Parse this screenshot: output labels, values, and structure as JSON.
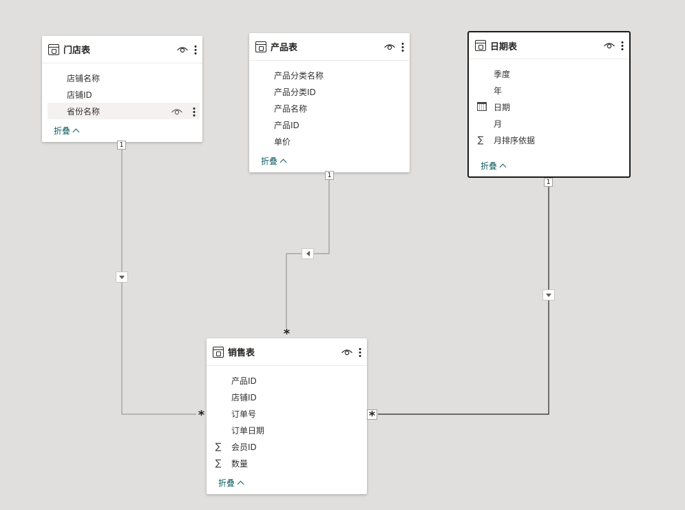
{
  "tables": [
    {
      "title": "门店表",
      "fields": [
        {
          "name": "店铺名称",
          "icon": ""
        },
        {
          "name": "店铺ID",
          "icon": ""
        },
        {
          "name": "省份名称",
          "icon": "",
          "hovered": true
        }
      ],
      "collapse_label": "折叠"
    },
    {
      "title": "产品表",
      "fields": [
        {
          "name": "产品分类名称",
          "icon": ""
        },
        {
          "name": "产品分类ID",
          "icon": ""
        },
        {
          "name": "产品名称",
          "icon": ""
        },
        {
          "name": "产品ID",
          "icon": ""
        },
        {
          "name": "单价",
          "icon": ""
        }
      ],
      "collapse_label": "折叠"
    },
    {
      "title": "日期表",
      "selected": true,
      "fields": [
        {
          "name": "季度",
          "icon": ""
        },
        {
          "name": "年",
          "icon": ""
        },
        {
          "name": "日期",
          "icon": "calendar-icon"
        },
        {
          "name": "月",
          "icon": ""
        },
        {
          "name": "月排序依据",
          "icon": "sigma-icon"
        }
      ],
      "collapse_label": "折叠"
    },
    {
      "title": "销售表",
      "fields": [
        {
          "name": "产品ID",
          "icon": ""
        },
        {
          "name": "店铺ID",
          "icon": ""
        },
        {
          "name": "订单号",
          "icon": ""
        },
        {
          "name": "订单日期",
          "icon": ""
        },
        {
          "name": "会员ID",
          "icon": "sigma-icon"
        },
        {
          "name": "数量",
          "icon": "sigma-icon"
        }
      ],
      "collapse_label": "折叠"
    }
  ],
  "relationships": [
    {
      "from": "门店表",
      "to": "销售表",
      "from_cardinality": "1",
      "to_cardinality": "*",
      "filter_direction": "single"
    },
    {
      "from": "产品表",
      "to": "销售表",
      "from_cardinality": "1",
      "to_cardinality": "*",
      "filter_direction": "single"
    },
    {
      "from": "日期表",
      "to": "销售表",
      "from_cardinality": "1",
      "to_cardinality": "*",
      "filter_direction": "single"
    }
  ],
  "sigma_glyph": "∑",
  "colors": {
    "canvas": "#e1dfdd",
    "card": "#ffffff",
    "link": "#0e5c5e",
    "line": "#8a8886"
  }
}
